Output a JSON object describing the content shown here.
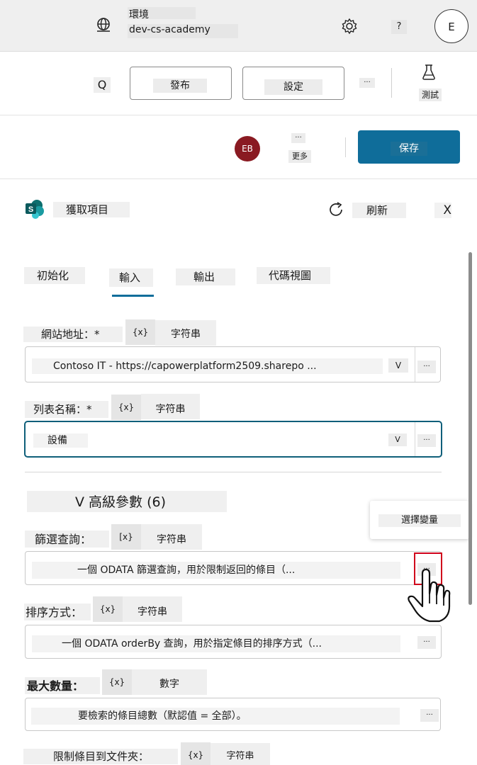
{
  "topbar": {
    "env_title": "環境",
    "env_name": "dev-cs-academy",
    "help": "?",
    "user_initial": "E",
    "icons": [
      "globe-icon",
      "gear-icon"
    ]
  },
  "commandbar": {
    "search_glyph": "Q",
    "publish": "發布",
    "settings": "設定",
    "more": "...",
    "test": "測試"
  },
  "savebar": {
    "avatar": "EB",
    "more_dots": "...",
    "more_label": "更多",
    "save": "保存"
  },
  "action": {
    "title": "獲取項目",
    "refresh": "刷新",
    "close": "X"
  },
  "tabs": [
    {
      "label": "初始化",
      "active": false
    },
    {
      "label": "輸入",
      "active": true
    },
    {
      "label": "輸出",
      "active": false
    },
    {
      "label": "代碼視圖",
      "active": false
    }
  ],
  "fields": {
    "site": {
      "label": "網站地址：*",
      "chip": "{x}",
      "type": "字符串",
      "value": "Contoso IT - https://capowerplatform2509.sharepo ...",
      "chevron": "V",
      "ellipsis": "..."
    },
    "list": {
      "label": "列表名稱：*",
      "chip": "{x}",
      "type": "字符串",
      "value": "設備",
      "chevron": "V",
      "ellipsis": "..."
    },
    "advanced": "V 高級參數 (6)",
    "tooltip": "選擇變量",
    "filter": {
      "label": "篩選查詢：",
      "chip": "[x}",
      "type": "字符串",
      "placeholder": "一個 ODATA 篩選查詢，用於限制返回的條目（...",
      "ellipsis": "..."
    },
    "orderby": {
      "label": "排序方式：",
      "chip": "{x}",
      "type": "字符串",
      "placeholder": "一個 ODATA orderBy 查詢，用於指定條目的排序方式（...",
      "ellipsis": "..."
    },
    "max": {
      "label": "最大數量：",
      "chip": "{x}",
      "type": "數字",
      "placeholder": "要檢索的條目總數（默認值 = 全部）。",
      "ellipsis": "..."
    },
    "folder": {
      "label": "限制條目到文件夾：",
      "chip": "{x}",
      "type": "字符串"
    }
  },
  "colors": {
    "accent": "#0f6d9a",
    "avatar_bg": "#8a1a22",
    "highlight_red": "#d0021b",
    "focus_border": "#0f5f7a"
  }
}
